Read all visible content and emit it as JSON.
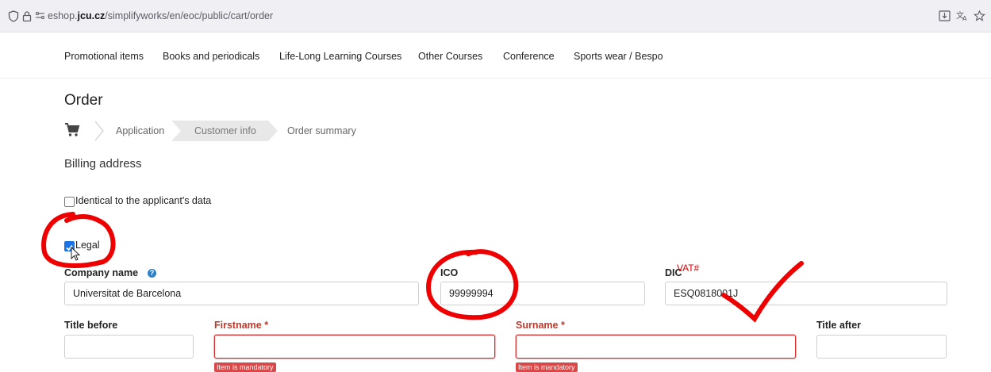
{
  "browser": {
    "url_prefix": "eshop.",
    "url_domain": "jcu.cz",
    "url_path": "/simplifyworks/en/eoc/public/cart/order"
  },
  "nav": {
    "items": [
      "Promotional items",
      "Books and periodicals",
      "Life-Long Learning Courses",
      "Other Courses",
      "Conference",
      "Sports wear / Bespo"
    ]
  },
  "page": {
    "title": "Order"
  },
  "steps": {
    "application": "Application",
    "customer_info": "Customer info",
    "order_summary": "Order summary"
  },
  "billing": {
    "heading": "Billing address",
    "identical_label": "Identical to the applicant's data",
    "identical_checked": false,
    "legal_label": "Legal",
    "legal_checked": true
  },
  "form": {
    "company_label": "Company name",
    "company_value": "Universitat de Barcelona",
    "ico_label": "ICO",
    "ico_value": "99999994",
    "dic_label": "DIC",
    "dic_value": "ESQ0818001J",
    "title_before_label": "Title before",
    "firstname_label": "Firstname *",
    "surname_label": "Surname *",
    "title_after_label": "Title after",
    "mandatory_msg": "Item is mandatory"
  },
  "annotation": {
    "vat_note": "VAT#",
    "color": "#e00000"
  }
}
